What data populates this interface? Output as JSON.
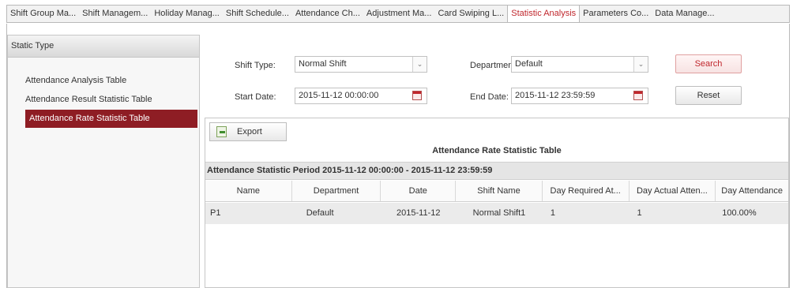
{
  "tabs": [
    {
      "label": "Shift Group Ma...",
      "active": false
    },
    {
      "label": "Shift Managem...",
      "active": false
    },
    {
      "label": "Holiday Manag...",
      "active": false
    },
    {
      "label": "Shift Schedule...",
      "active": false
    },
    {
      "label": "Attendance Ch...",
      "active": false
    },
    {
      "label": "Adjustment Ma...",
      "active": false
    },
    {
      "label": "Card Swiping L...",
      "active": false
    },
    {
      "label": "Statistic Analysis",
      "active": true
    },
    {
      "label": "Parameters Co...",
      "active": false
    },
    {
      "label": "Data Manage...",
      "active": false
    }
  ],
  "sidebar": {
    "header": "Static Type",
    "items": [
      {
        "label": "Attendance Analysis Table"
      },
      {
        "label": "Attendance Result Statistic Table"
      },
      {
        "label": "Attendance Rate Statistic Table",
        "active": true
      }
    ]
  },
  "filters": {
    "shift_type_label": "Shift Type:",
    "shift_type_value": "Normal Shift",
    "department_label": "Department:",
    "department_value": "Default",
    "start_date_label": "Start Date:",
    "start_date_value": "2015-11-12 00:00:00",
    "end_date_label": "End Date:",
    "end_date_value": "2015-11-12 23:59:59",
    "search_label": "Search",
    "reset_label": "Reset"
  },
  "table": {
    "export_label": "Export",
    "title": "Attendance Rate Statistic Table",
    "period": "Attendance Statistic Period 2015-11-12 00:00:00 - 2015-11-12 23:59:59",
    "columns": [
      "Name",
      "Department",
      "Date",
      "Shift Name",
      "Day Required At...",
      "Day Actual Atten...",
      "Day Attendance"
    ],
    "rows": [
      [
        "P1",
        "Default",
        "2015-11-12",
        "Normal Shift1",
        "1",
        "1",
        "100.00%"
      ]
    ]
  },
  "colors": {
    "accent": "#8e1d24",
    "active_tab_text": "#c0272d"
  }
}
